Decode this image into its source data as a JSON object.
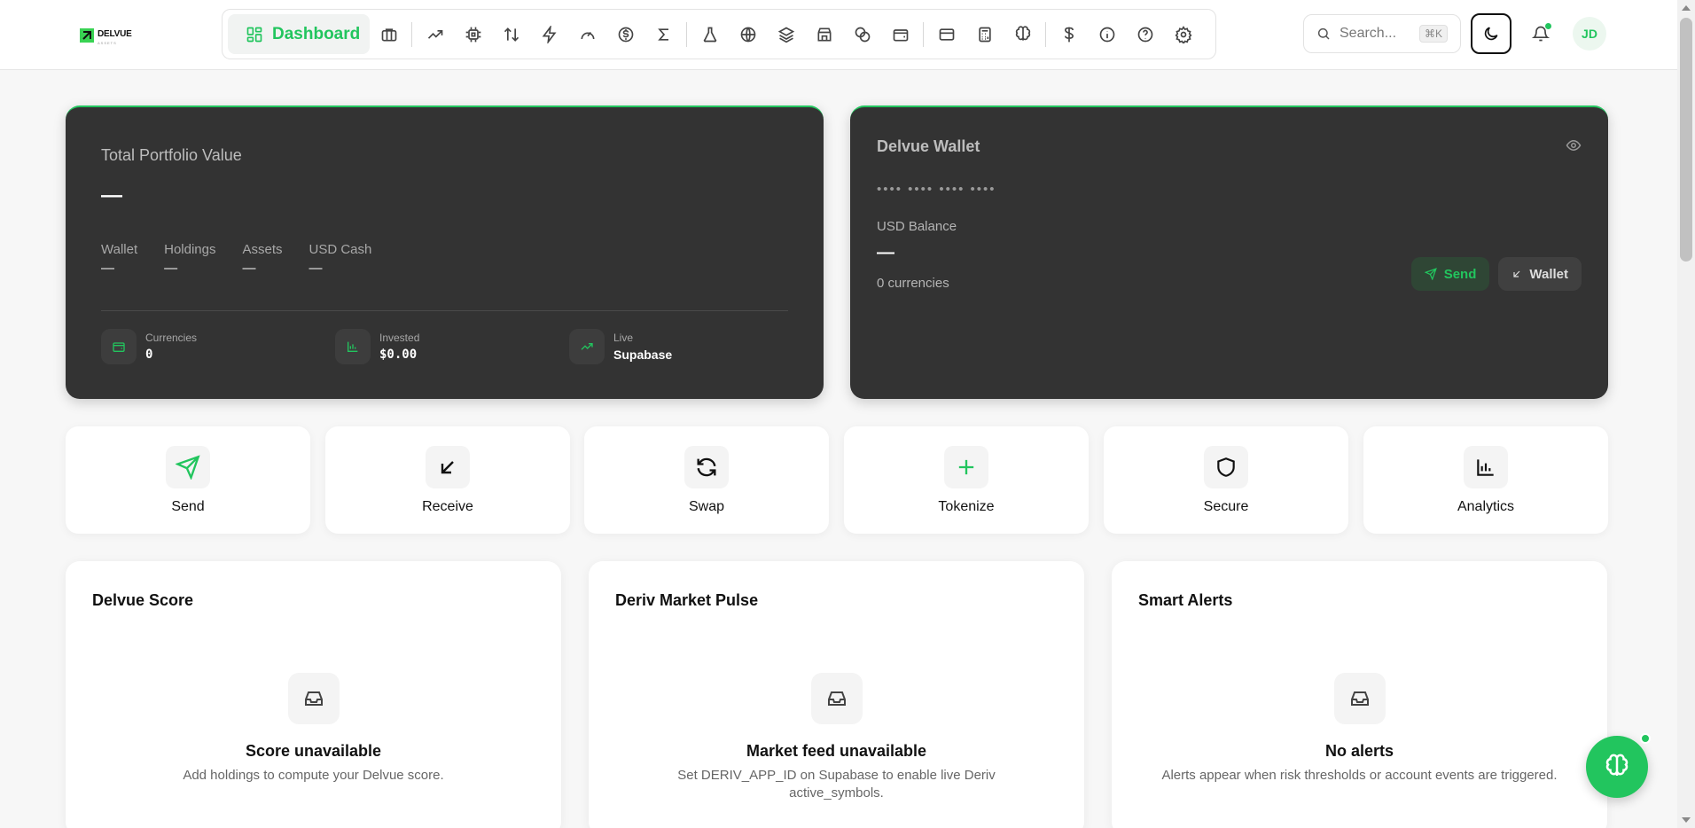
{
  "brand": {
    "name": "DELVUE",
    "sub": "ASSETS"
  },
  "nav": {
    "active_label": "Dashboard",
    "icons": [
      "briefcase-icon",
      "trending-up-icon",
      "cpu-icon",
      "arrows-up-down-icon",
      "zap-icon",
      "gauge-icon",
      "dollar-circle-icon",
      "sigma-icon",
      "flask-icon",
      "globe-icon",
      "layers-icon",
      "store-icon",
      "coins-icon",
      "wallet-icon",
      "credit-card-icon",
      "calculator-icon",
      "brain-icon",
      "dollar-icon",
      "info-icon",
      "help-icon",
      "settings-icon"
    ]
  },
  "search": {
    "placeholder": "Search...",
    "shortcut": "⌘K"
  },
  "user": {
    "initials": "JD"
  },
  "colors": {
    "accent": "#22c55e",
    "card_dark": "#333333"
  },
  "portfolio": {
    "title": "Total Portfolio Value",
    "value": "—",
    "metrics": [
      {
        "label": "Wallet",
        "value": "—"
      },
      {
        "label": "Holdings",
        "value": "—"
      },
      {
        "label": "Assets",
        "value": "—"
      },
      {
        "label": "USD Cash",
        "value": "—"
      }
    ],
    "stats": [
      {
        "label": "Currencies",
        "value": "0",
        "icon": "wallet-icon"
      },
      {
        "label": "Invested",
        "value": "$0.00",
        "icon": "bar-chart-icon"
      },
      {
        "label": "Live",
        "value": "Supabase",
        "icon": "trending-up-icon"
      }
    ]
  },
  "wallet": {
    "title": "Delvue Wallet",
    "masked": "•••• •••• •••• ••••",
    "balance_label": "USD Balance",
    "balance": "—",
    "currencies": "0 currencies",
    "send_label": "Send",
    "wallet_label": "Wallet"
  },
  "actions": [
    {
      "label": "Send",
      "icon": "send-icon"
    },
    {
      "label": "Receive",
      "icon": "arrow-down-left-icon"
    },
    {
      "label": "Swap",
      "icon": "refresh-icon"
    },
    {
      "label": "Tokenize",
      "icon": "plus-icon"
    },
    {
      "label": "Secure",
      "icon": "shield-icon"
    },
    {
      "label": "Analytics",
      "icon": "bar-chart-icon"
    }
  ],
  "cards": [
    {
      "title": "Delvue Score",
      "heading": "Score unavailable",
      "desc": "Add holdings to compute your Delvue score."
    },
    {
      "title": "Deriv Market Pulse",
      "heading": "Market feed unavailable",
      "desc": "Set DERIV_APP_ID on Supabase to enable live Deriv active_symbols."
    },
    {
      "title": "Smart Alerts",
      "heading": "No alerts",
      "desc": "Alerts appear when risk thresholds or account events are triggered."
    }
  ]
}
